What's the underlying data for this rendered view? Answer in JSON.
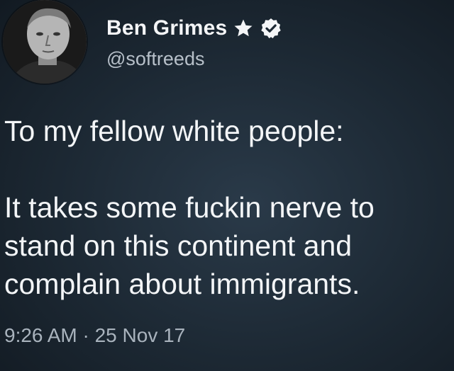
{
  "tweet": {
    "author": {
      "display_name": "Ben Grimes",
      "handle": "@softreeds",
      "badges": [
        "star-icon",
        "verified-badge-icon"
      ]
    },
    "body": {
      "paragraph_1": "To my fellow white people:",
      "paragraph_2": "It takes some fuckin nerve to\nstand on this continent and\ncomplain about immigrants."
    },
    "timestamp": "9:26 AM · 25 Nov 17"
  },
  "colors": {
    "background": "#1c2833",
    "text": "#f3f5f7",
    "muted": "#a9b3bd"
  }
}
